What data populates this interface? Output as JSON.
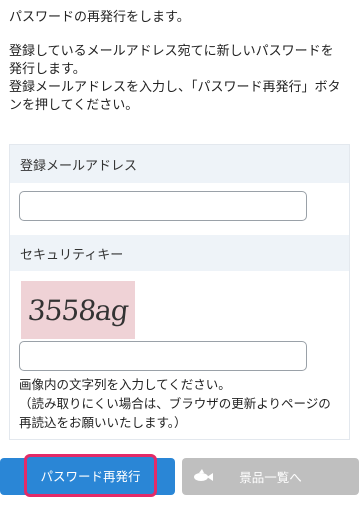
{
  "intro": {
    "line1": "パスワードの再発行をします。",
    "line2": "登録しているメールアドレス宛てに新しいパスワードを",
    "line3": "発行します。",
    "line4": "登録メールアドレスを入力し、「パスワード再発行」ボタ",
    "line5": "ンを押してください。"
  },
  "form": {
    "email_label": "登録メールアドレス",
    "email_value": "",
    "security_label": "セキュリティキー",
    "captcha_text": "3558ag",
    "security_value": "",
    "help_line1": "画像内の文字列を入力してください。",
    "help_line2": "（読み取りにくい場合は、ブラウザの更新よりページの",
    "help_line3": "再読込をお願いいたします。）"
  },
  "buttons": {
    "reissue_label": "パスワード再発行",
    "prize_list_label": "景品一覧へ"
  },
  "colors": {
    "primary": "#2a86d6",
    "highlight_border": "#e32a67",
    "disabled": "#bfbfbf",
    "section_header": "#eef3f8",
    "captcha_bg": "#efd2d6"
  }
}
